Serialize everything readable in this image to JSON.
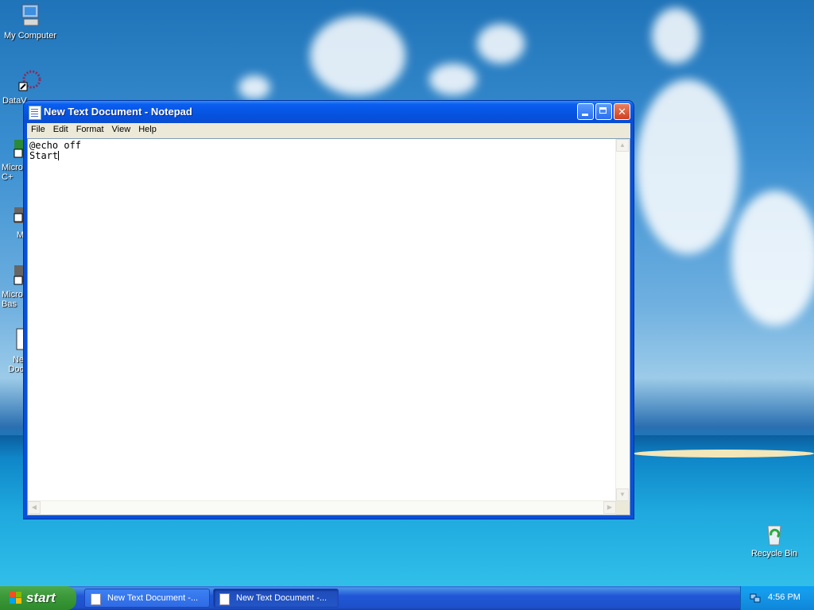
{
  "desktop": {
    "icons": [
      {
        "label": "My Computer"
      },
      {
        "label": "DataV"
      },
      {
        "label": "Micros C+"
      },
      {
        "label": "M"
      },
      {
        "label": "Micros Bas"
      },
      {
        "label": "Ne Doc"
      }
    ],
    "recycle_bin": {
      "label": "Recycle Bin"
    }
  },
  "notepad": {
    "title": "New Text Document - Notepad",
    "menu": [
      "File",
      "Edit",
      "Format",
      "View",
      "Help"
    ],
    "content_lines": [
      "@echo off",
      "Start"
    ]
  },
  "taskbar": {
    "start_label": "start",
    "tasks": [
      {
        "label": "New Text Document -..."
      },
      {
        "label": "New Text Document -..."
      }
    ],
    "clock": "4:56 PM"
  }
}
